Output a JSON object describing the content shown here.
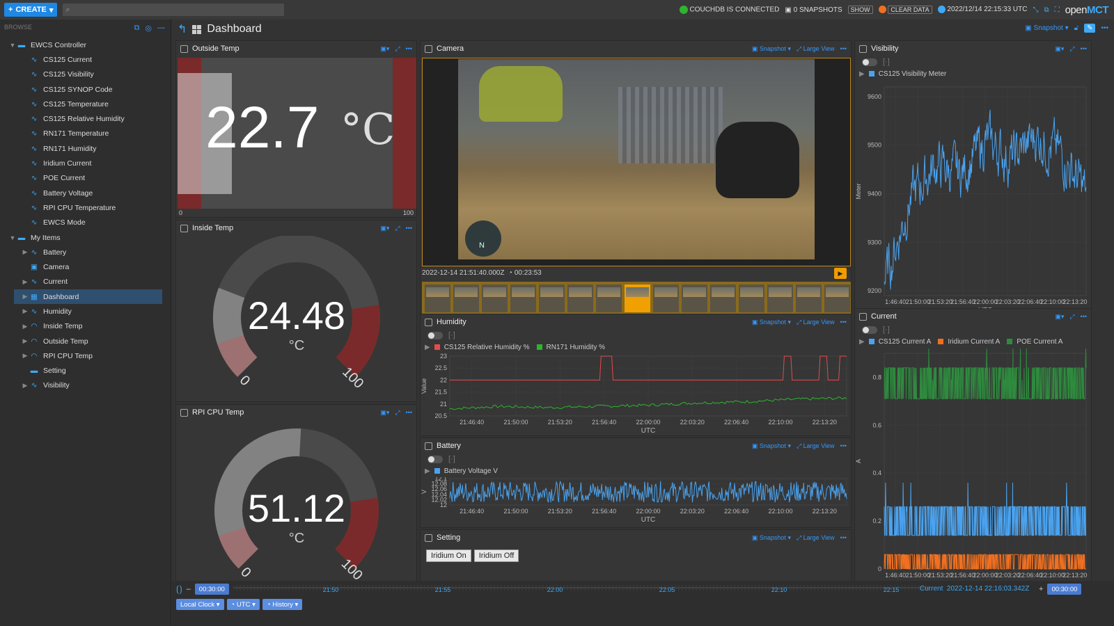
{
  "topbar": {
    "create_label": "CREATE",
    "couchdb_status": "COUCHDB IS CONNECTED",
    "snapshots": "0 SNAPSHOTS",
    "show_label": "SHOW",
    "clear_data": "CLEAR DATA",
    "clock": "2022/12/14 22:15:33 UTC",
    "logo_prefix": "open",
    "logo_suffix": "MCT"
  },
  "sidebar": {
    "browse_label": "BROWSE",
    "items": [
      {
        "label": "EWCS Controller",
        "icon": "folder-icon",
        "level": 0,
        "expanded": true
      },
      {
        "label": "CS125 Current",
        "icon": "telemetry-icon",
        "level": 1
      },
      {
        "label": "CS125 Visibility",
        "icon": "telemetry-icon",
        "level": 1
      },
      {
        "label": "CS125 SYNOP Code",
        "icon": "telemetry-icon",
        "level": 1
      },
      {
        "label": "CS125 Temperature",
        "icon": "telemetry-icon",
        "level": 1
      },
      {
        "label": "CS125 Relative Humidity",
        "icon": "telemetry-icon",
        "level": 1
      },
      {
        "label": "RN171 Temperature",
        "icon": "telemetry-icon",
        "level": 1
      },
      {
        "label": "RN171 Humidity",
        "icon": "telemetry-icon",
        "level": 1
      },
      {
        "label": "Iridium Current",
        "icon": "telemetry-icon",
        "level": 1
      },
      {
        "label": "POE Current",
        "icon": "telemetry-icon",
        "level": 1
      },
      {
        "label": "Battery Voltage",
        "icon": "telemetry-icon",
        "level": 1
      },
      {
        "label": "RPI CPU Temperature",
        "icon": "telemetry-icon",
        "level": 1
      },
      {
        "label": "EWCS Mode",
        "icon": "telemetry-icon",
        "level": 1
      },
      {
        "label": "My Items",
        "icon": "folder-icon",
        "level": 0,
        "expanded": true
      },
      {
        "label": "Battery",
        "icon": "plot-icon",
        "level": 1,
        "arrow": true
      },
      {
        "label": "Camera",
        "icon": "image-icon",
        "level": 1
      },
      {
        "label": "Current",
        "icon": "plot-icon",
        "level": 1,
        "arrow": true
      },
      {
        "label": "Dashboard",
        "icon": "dashboard-icon",
        "level": 1,
        "arrow": true,
        "selected": true
      },
      {
        "label": "Humidity",
        "icon": "plot-icon",
        "level": 1,
        "arrow": true
      },
      {
        "label": "Inside Temp",
        "icon": "gauge-icon",
        "level": 1,
        "arrow": true
      },
      {
        "label": "Outside Temp",
        "icon": "gauge-icon",
        "level": 1,
        "arrow": true
      },
      {
        "label": "RPI CPU Temp",
        "icon": "gauge-icon",
        "level": 1,
        "arrow": true
      },
      {
        "label": "Setting",
        "icon": "folder-icon",
        "level": 1
      },
      {
        "label": "Visibility",
        "icon": "plot-icon",
        "level": 1,
        "arrow": true
      }
    ]
  },
  "dashboard": {
    "title": "Dashboard",
    "snapshot_label": "Snapshot"
  },
  "outside_temp": {
    "title": "Outside Temp",
    "value": "22.7",
    "unit": "°C",
    "min": "0",
    "max": "100",
    "level": 0.227
  },
  "inside_temp": {
    "title": "Inside Temp",
    "value": "24.48",
    "unit": "°C",
    "min": "0",
    "max": "100",
    "level": 0.2448
  },
  "cpu_temp": {
    "title": "RPI CPU Temp",
    "value": "51.12",
    "unit": "°C",
    "min": "0",
    "max": "100",
    "level": 0.5112
  },
  "camera": {
    "title": "Camera",
    "snapshot": "Snapshot",
    "large_view": "Large View",
    "timestamp": "2022-12-14 21:51:40.000Z",
    "duration": "00:23:53"
  },
  "humidity": {
    "title": "Humidity",
    "snapshot": "Snapshot",
    "large_view": "Large View",
    "legend": [
      {
        "name": "CS125 Relative Humidity %",
        "color": "#e84a4a"
      },
      {
        "name": "RN171 Humidity %",
        "color": "#2db52d"
      }
    ],
    "ylabel": "Value",
    "yticks": [
      "23",
      "22.5",
      "22",
      "21.5",
      "21",
      "20.5"
    ],
    "xticks": [
      "21:46:40",
      "21:50:00",
      "21:53:20",
      "21:56:40",
      "22:00:00",
      "22:03:20",
      "22:06:40",
      "22:10:00",
      "22:13:20"
    ],
    "xlabel": "UTC"
  },
  "battery": {
    "title": "Battery",
    "snapshot": "Snapshot",
    "large_view": "Large View",
    "legend": [
      {
        "name": "Battery Voltage V",
        "color": "#4aa3f0"
      }
    ],
    "ylabel": "V",
    "yticks": [
      "12.1",
      "12.08",
      "12.06",
      "12.04",
      "12.02",
      "12"
    ],
    "xticks": [
      "21:46:40",
      "21:50:00",
      "21:53:20",
      "21:56:40",
      "22:00:00",
      "22:03:20",
      "22:06:40",
      "22:10:00",
      "22:13:20"
    ],
    "xlabel": "UTC"
  },
  "setting": {
    "title": "Setting",
    "snapshot": "Snapshot",
    "large_view": "Large View",
    "btn_on": "Iridium On",
    "btn_off": "Iridium Off"
  },
  "visibility": {
    "title": "Visibility",
    "legend": [
      {
        "name": "CS125 Visibility Meter",
        "color": "#4aa3f0"
      }
    ],
    "ylabel": "Meter",
    "yticks": [
      "9600",
      "9500",
      "9400",
      "9300",
      "9200"
    ],
    "xticks": [
      "1:46:40",
      "21:50:00",
      "21:53:20",
      "21:56:40",
      "22:00:00",
      "22:03:20",
      "22:06:40",
      "22:10:00",
      "22:13:20"
    ],
    "xlabel": "UTC"
  },
  "current": {
    "title": "Current",
    "legend": [
      {
        "name": "CS125 Current A",
        "color": "#4aa3f0"
      },
      {
        "name": "Iridium Current A",
        "color": "#f07020"
      },
      {
        "name": "POE Current A",
        "color": "#2e8b3e"
      }
    ],
    "ylabel": "A",
    "yticks": [
      "0.8",
      "0.6",
      "0.4",
      "0.2",
      "0"
    ],
    "xticks": [
      "1:46:40",
      "21:50:00",
      "21:53:20",
      "21:56:40",
      "22:00:00",
      "22:03:20",
      "22:06:40",
      "22:10:00",
      "22:13:20"
    ],
    "xlabel": "UTC"
  },
  "timeline": {
    "start_offset": "00:30:00",
    "end_offset": "00:30:00",
    "ticks": [
      "21:50",
      "21:55",
      "22:00",
      "22:05",
      "22:10",
      "22:15"
    ],
    "current_label": "Current",
    "current_time": "2022-12-14 22:16:03.342Z",
    "clock_label": "Local Clock",
    "tz_label": "UTC",
    "mode_label": "History"
  },
  "chart_data": [
    {
      "type": "line",
      "title": "Humidity",
      "xlabel": "UTC",
      "ylabel": "Value",
      "ylim": [
        20.5,
        23
      ],
      "x": [
        "21:46:40",
        "21:50:00",
        "21:53:20",
        "21:56:40",
        "22:00:00",
        "22:03:20",
        "22:06:40",
        "22:10:00",
        "22:13:20"
      ],
      "series": [
        {
          "name": "CS125 Relative Humidity %",
          "values": [
            22,
            22,
            22,
            22,
            22,
            22,
            22,
            22,
            22
          ]
        },
        {
          "name": "RN171 Humidity %",
          "values": [
            20.8,
            20.9,
            20.85,
            20.9,
            20.95,
            21.05,
            21.1,
            21.2,
            21.25
          ]
        }
      ]
    },
    {
      "type": "line",
      "title": "Battery",
      "xlabel": "UTC",
      "ylabel": "V",
      "ylim": [
        12,
        12.1
      ],
      "x": [
        "21:46:40",
        "21:50:00",
        "21:53:20",
        "21:56:40",
        "22:00:00",
        "22:03:20",
        "22:06:40",
        "22:10:00",
        "22:13:20"
      ],
      "series": [
        {
          "name": "Battery Voltage V",
          "values": [
            12.04,
            12.05,
            12.04,
            12.05,
            12.04,
            12.05,
            12.04,
            12.05,
            12.04
          ]
        }
      ]
    },
    {
      "type": "line",
      "title": "Visibility",
      "xlabel": "UTC",
      "ylabel": "Meter",
      "ylim": [
        9190,
        9620
      ],
      "x": [
        "21:46:40",
        "21:50:00",
        "21:53:20",
        "21:56:40",
        "22:00:00",
        "22:03:20",
        "22:06:40",
        "22:10:00",
        "22:13:20"
      ],
      "series": [
        {
          "name": "CS125 Visibility Meter",
          "values": [
            9220,
            9390,
            9460,
            9440,
            9510,
            9470,
            9520,
            9480,
            9400
          ]
        }
      ]
    },
    {
      "type": "line",
      "title": "Current",
      "xlabel": "UTC",
      "ylabel": "A",
      "ylim": [
        0,
        0.9
      ],
      "x": [
        "21:46:40",
        "21:50:00",
        "21:53:20",
        "21:56:40",
        "22:00:00",
        "22:03:20",
        "22:06:40",
        "22:10:00",
        "22:13:20"
      ],
      "series": [
        {
          "name": "CS125 Current A",
          "values": [
            0.19,
            0.19,
            0.19,
            0.19,
            0.19,
            0.19,
            0.19,
            0.19,
            0.19
          ]
        },
        {
          "name": "Iridium Current A",
          "values": [
            0.03,
            0.03,
            0.03,
            0.03,
            0.03,
            0.03,
            0.03,
            0.03,
            0.03
          ]
        },
        {
          "name": "POE Current A",
          "values": [
            0.77,
            0.77,
            0.77,
            0.77,
            0.77,
            0.77,
            0.77,
            0.77,
            0.77
          ]
        }
      ]
    }
  ]
}
